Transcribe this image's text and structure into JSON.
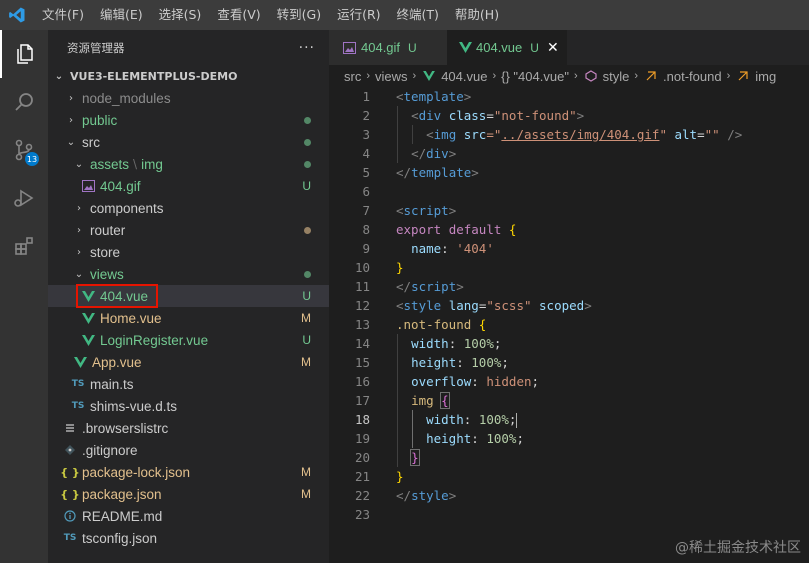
{
  "menu": [
    "文件(F)",
    "编辑(E)",
    "选择(S)",
    "查看(V)",
    "转到(G)",
    "运行(R)",
    "终端(T)",
    "帮助(H)"
  ],
  "activity": {
    "scm_badge": "13"
  },
  "sidebar": {
    "title": "资源管理器",
    "more": "···",
    "project": "VUE3-ELEMENTPLUS-DEMO",
    "items": [
      {
        "label": "node_modules"
      },
      {
        "label": "public"
      },
      {
        "label": "src"
      },
      {
        "label": "assets",
        "label2": "img"
      },
      {
        "label": "404.gif",
        "status": "U"
      },
      {
        "label": "components"
      },
      {
        "label": "router"
      },
      {
        "label": "store"
      },
      {
        "label": "views"
      },
      {
        "label": "404.vue",
        "status": "U"
      },
      {
        "label": "Home.vue",
        "status": "M"
      },
      {
        "label": "LoginRegister.vue",
        "status": "U"
      },
      {
        "label": "App.vue",
        "status": "M"
      },
      {
        "label": "main.ts",
        "icon": "TS"
      },
      {
        "label": "shims-vue.d.ts",
        "icon": "TS"
      },
      {
        "label": ".browserslistrc"
      },
      {
        "label": ".gitignore"
      },
      {
        "label": "package-lock.json",
        "status": "M",
        "icon": "{ }"
      },
      {
        "label": "package.json",
        "status": "M",
        "icon": "{ }"
      },
      {
        "label": "README.md"
      },
      {
        "label": "tsconfig.json",
        "icon": "TS"
      }
    ]
  },
  "tabs": [
    {
      "label": "404.gif",
      "status": "U"
    },
    {
      "label": "404.vue",
      "status": "U",
      "close": "✕"
    }
  ],
  "breadcrumb": [
    "src",
    "views",
    "404.vue",
    "{} \"404.vue\"",
    "style",
    ".not-found",
    "img"
  ],
  "editor": {
    "current_line": 18,
    "line_numbers": [
      "1",
      "2",
      "3",
      "4",
      "5",
      "6",
      "7",
      "8",
      "9",
      "10",
      "11",
      "12",
      "13",
      "14",
      "15",
      "16",
      "17",
      "18",
      "19",
      "20",
      "21",
      "22",
      "23"
    ]
  },
  "code": {
    "l1": [
      "<",
      "template",
      ">"
    ],
    "l2": [
      "<",
      "div",
      "class",
      "=",
      "\"not-found\"",
      ">"
    ],
    "l3": [
      "<",
      "img",
      "src",
      "=\"",
      "../assets/img/404.gif",
      "\"",
      "alt",
      "=",
      "\"\"",
      "/>"
    ],
    "l4": [
      "</",
      "div",
      ">"
    ],
    "l5": [
      "</",
      "template",
      ">"
    ],
    "l7": [
      "<",
      "script",
      ">"
    ],
    "l8": [
      "export",
      "default",
      "{"
    ],
    "l9": [
      "name",
      ":",
      "'404'"
    ],
    "l10": [
      "}"
    ],
    "l11": [
      "</",
      "script",
      ">"
    ],
    "l12": [
      "<",
      "style",
      "lang",
      "=",
      "\"scss\"",
      "scoped",
      ">"
    ],
    "l13": [
      ".not-found",
      "{"
    ],
    "l14": [
      "width",
      ":",
      "100%",
      ";"
    ],
    "l15": [
      "height",
      ":",
      "100%",
      ";"
    ],
    "l16": [
      "overflow",
      ":",
      "hidden",
      ";"
    ],
    "l17": [
      "img",
      "{"
    ],
    "l18": [
      "width",
      ":",
      "100%",
      ";"
    ],
    "l19": [
      "height",
      ":",
      "100%",
      ";"
    ],
    "l20": [
      "}"
    ],
    "l21": [
      "}"
    ],
    "l22": [
      "</",
      "style",
      ">"
    ]
  },
  "watermark": "@稀土掘金技术社区",
  "colors": {
    "accent": "#007acc",
    "untracked": "#73c991",
    "modified": "#e2c08d",
    "highlight": "#e51400"
  }
}
